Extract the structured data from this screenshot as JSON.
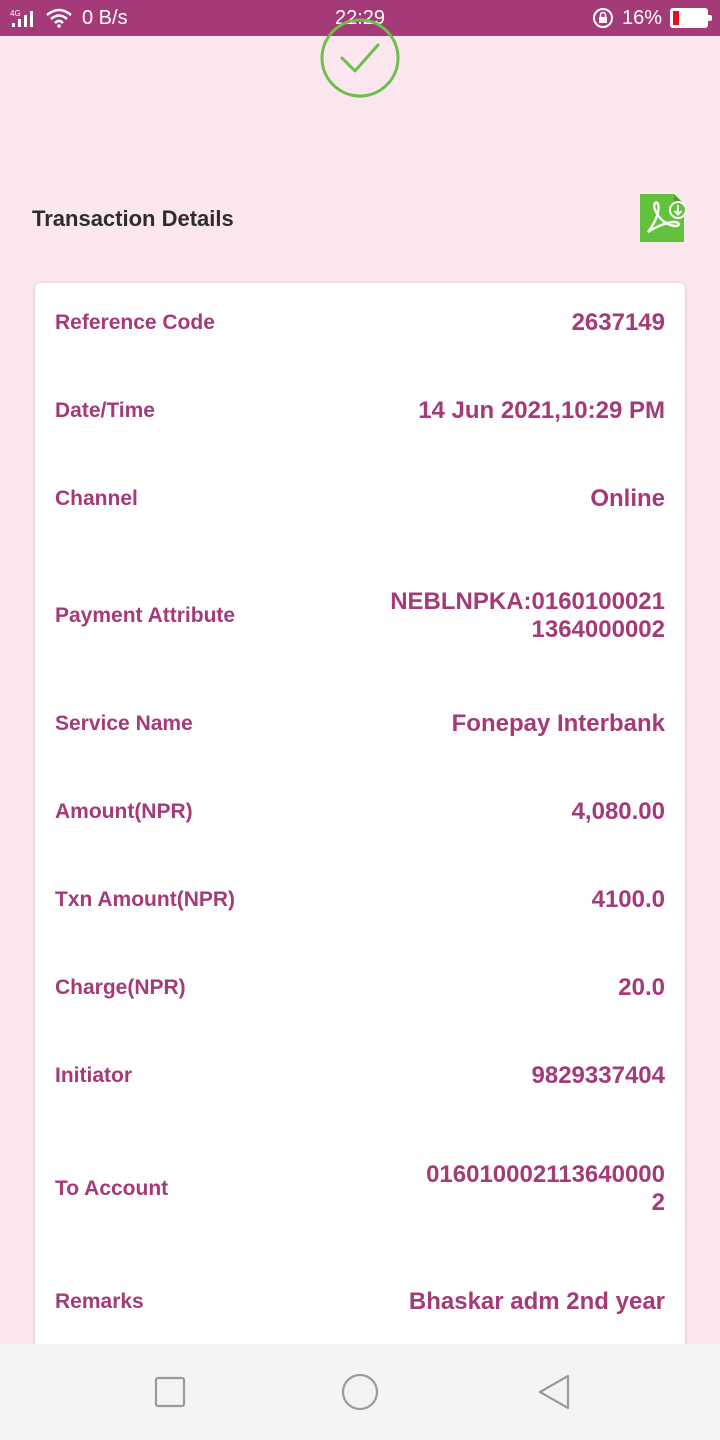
{
  "status_bar": {
    "network_type": "4G",
    "speed": "0 B/s",
    "time": "22:29",
    "battery": "16%"
  },
  "page": {
    "section_title": "Transaction Details"
  },
  "details": [
    {
      "label": "Reference Code",
      "value": "2637149"
    },
    {
      "label": "Date/Time",
      "value": "14 Jun 2021,10:29 PM"
    },
    {
      "label": "Channel",
      "value": "Online"
    },
    {
      "label": "Payment Attribute",
      "value": "NEBLNPKA:0160100021\n1364000002"
    },
    {
      "label": "Service Name",
      "value": "Fonepay Interbank"
    },
    {
      "label": "Amount(NPR)",
      "value": "4,080.00"
    },
    {
      "label": "Txn Amount(NPR)",
      "value": "4100.0"
    },
    {
      "label": "Charge(NPR)",
      "value": "20.0"
    },
    {
      "label": "Initiator",
      "value": "9829337404"
    },
    {
      "label": "To Account",
      "value": "016010002113640000\n2"
    },
    {
      "label": "Remarks",
      "value": "Bhaskar adm 2nd year"
    }
  ],
  "colors": {
    "accent": "#a53a78",
    "background": "#fce6f0",
    "success": "#6cc04a",
    "pdf_icon": "#62c23c"
  },
  "icons": {
    "success": "check-circle-icon",
    "pdf": "pdf-download-icon",
    "nav_recents": "square-icon",
    "nav_home": "circle-icon",
    "nav_back": "triangle-back-icon"
  }
}
